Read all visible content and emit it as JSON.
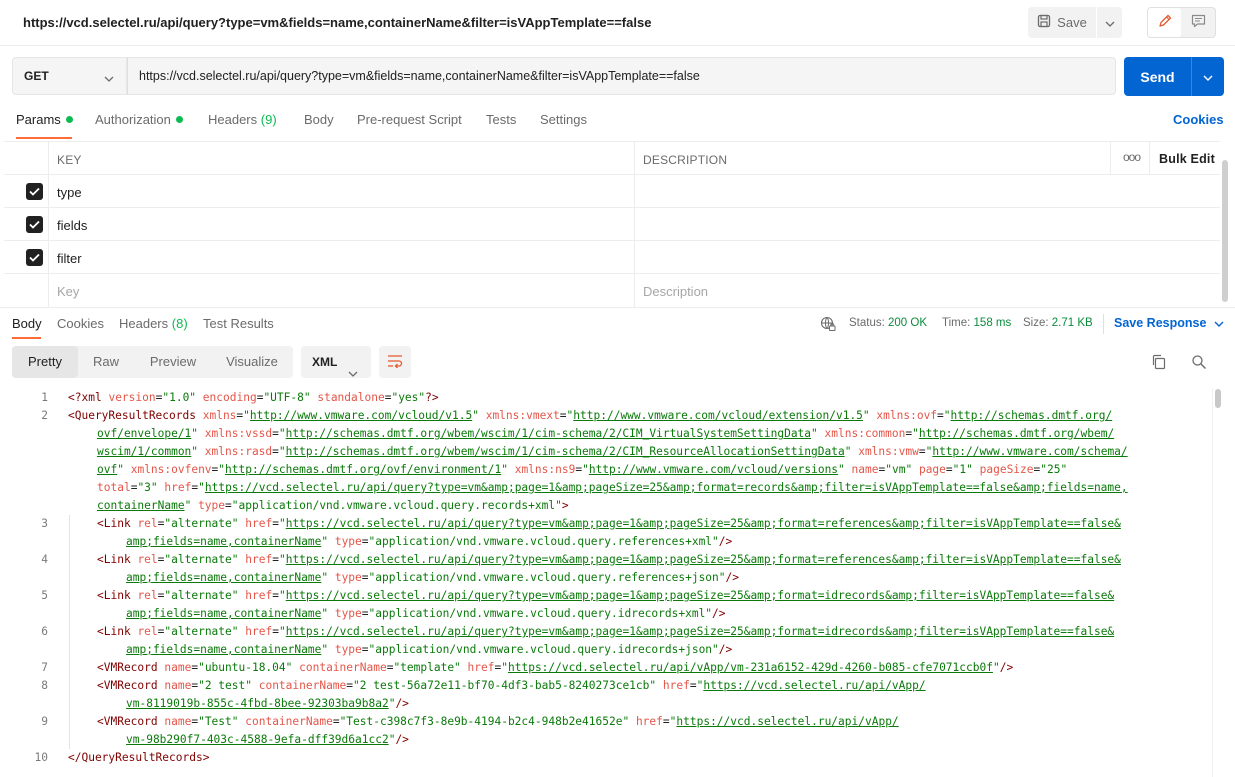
{
  "title": "https://vcd.selectel.ru/api/query?type=vm&fields=name,containerName&filter=isVAppTemplate==false",
  "toolbar": {
    "save_label": "Save"
  },
  "request": {
    "method": "GET",
    "url": "https://vcd.selectel.ru/api/query?type=vm&fields=name,containerName&filter=isVAppTemplate==false",
    "send_label": "Send"
  },
  "req_tabs": {
    "params": "Params",
    "authorization": "Authorization",
    "headers": "Headers",
    "headers_count": "(9)",
    "body": "Body",
    "prerequest": "Pre-request Script",
    "tests": "Tests",
    "settings": "Settings",
    "cookies": "Cookies"
  },
  "params": {
    "col_key": "KEY",
    "col_desc": "DESCRIPTION",
    "more": "ooo",
    "bulk_edit": "Bulk Edit",
    "rows": [
      {
        "key": "type",
        "checked": true
      },
      {
        "key": "fields",
        "checked": true
      },
      {
        "key": "filter",
        "checked": true
      }
    ],
    "key_placeholder": "Key",
    "desc_placeholder": "Description"
  },
  "resp_tabs": {
    "body": "Body",
    "cookies": "Cookies",
    "headers": "Headers",
    "headers_count": "(8)",
    "test_results": "Test Results"
  },
  "response": {
    "status_label": "Status:",
    "status": "200 OK",
    "time_label": "Time:",
    "time": "158 ms",
    "size_label": "Size:",
    "size": "2.71 KB",
    "save_response": "Save Response"
  },
  "view": {
    "pretty": "Pretty",
    "raw": "Raw",
    "preview": "Preview",
    "visualize": "Visualize",
    "format": "XML"
  },
  "code": {
    "line_numbers": [
      "1",
      "2",
      "3",
      "4",
      "5",
      "6",
      "7",
      "8",
      "9",
      "10"
    ]
  }
}
